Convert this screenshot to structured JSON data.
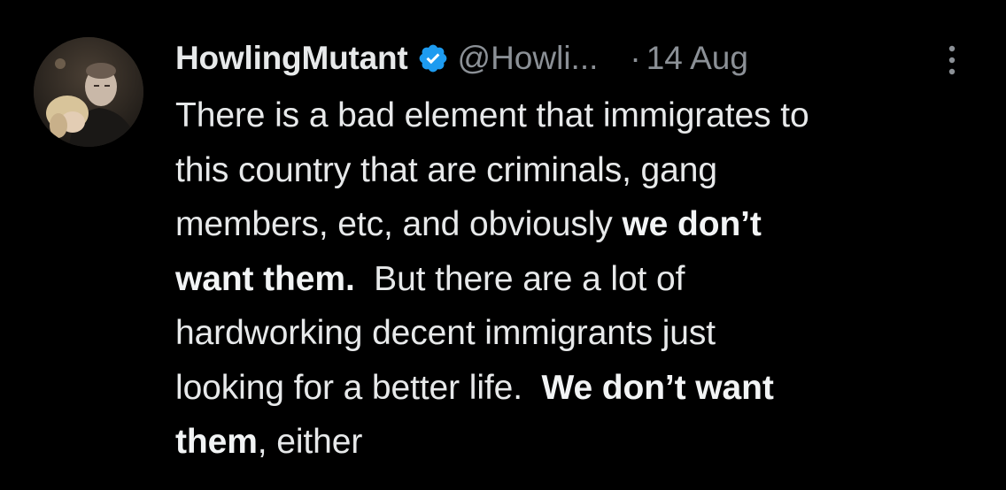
{
  "tweet": {
    "display_name": "HowlingMutant",
    "handle": "@Howli...",
    "separator": "·",
    "time": "14 Aug",
    "lines": [
      [
        {
          "text": "There is a bad element that immigrates to",
          "bold": false
        }
      ],
      [
        {
          "text": "this country that are criminals, gang",
          "bold": false
        }
      ],
      [
        {
          "text": "members, etc, and obviously ",
          "bold": false
        },
        {
          "text": "we don’t",
          "bold": true
        }
      ],
      [
        {
          "text": "want them.",
          "bold": true
        },
        {
          "text": "  But there are a lot of",
          "bold": false
        }
      ],
      [
        {
          "text": "hardworking decent immigrants just",
          "bold": false
        }
      ],
      [
        {
          "text": "looking for a better life.  ",
          "bold": false
        },
        {
          "text": "We don’t want",
          "bold": true
        }
      ],
      [
        {
          "text": "them",
          "bold": true
        },
        {
          "text": ", either",
          "bold": false
        }
      ]
    ]
  },
  "icons": {
    "verified": "verified-badge-icon",
    "more": "more-vertical-icon"
  },
  "colors": {
    "background": "#000000",
    "text": "#e7e9ea",
    "secondary_text": "#8b9096",
    "verified": "#1d9bf0"
  }
}
